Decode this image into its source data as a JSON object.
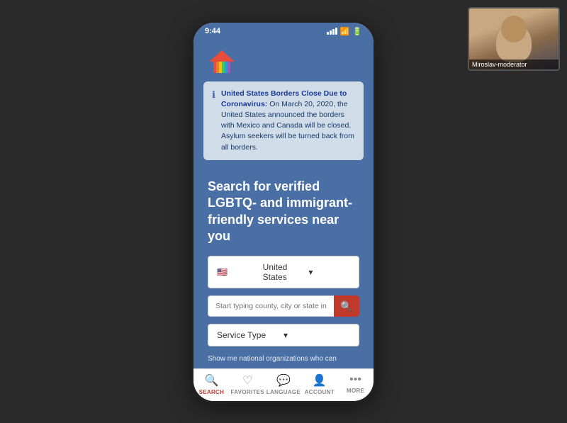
{
  "screen": {
    "bg_color": "#2a2a2a"
  },
  "webcam": {
    "label": "Miroslav-moderator"
  },
  "status_bar": {
    "time": "9:44",
    "wifi": true,
    "battery": true
  },
  "notification": {
    "title": "United States Borders Close Due to Coronavirus:",
    "body": "On March 20, 2020, the United States announced the borders with Mexico and Canada will be closed. Asylum seekers will be turned back from all borders."
  },
  "search": {
    "heading": "Search for verified LGBTQ- and immigrant-friendly services near you",
    "country_label": "United States",
    "country_chevron": "▾",
    "search_placeholder": "Start typing county, city or state in th",
    "service_type_label": "Service Type",
    "service_type_chevron": "▾",
    "national_orgs_text": "Show me national organizations who can"
  },
  "bottom_nav": {
    "items": [
      {
        "icon": "🔍",
        "label": "SEARCH",
        "active": true
      },
      {
        "icon": "♡",
        "label": "FAVORITES",
        "active": false
      },
      {
        "icon": "💬",
        "label": "LANGUAGE",
        "active": false
      },
      {
        "icon": "👤",
        "label": "ACCOUNT",
        "active": false
      },
      {
        "icon": "···",
        "label": "MORE",
        "active": false
      }
    ]
  },
  "rainbow_colors": [
    "#e74c3c",
    "#e67e22",
    "#f1c40f",
    "#2ecc71",
    "#3498db",
    "#9b59b6"
  ]
}
